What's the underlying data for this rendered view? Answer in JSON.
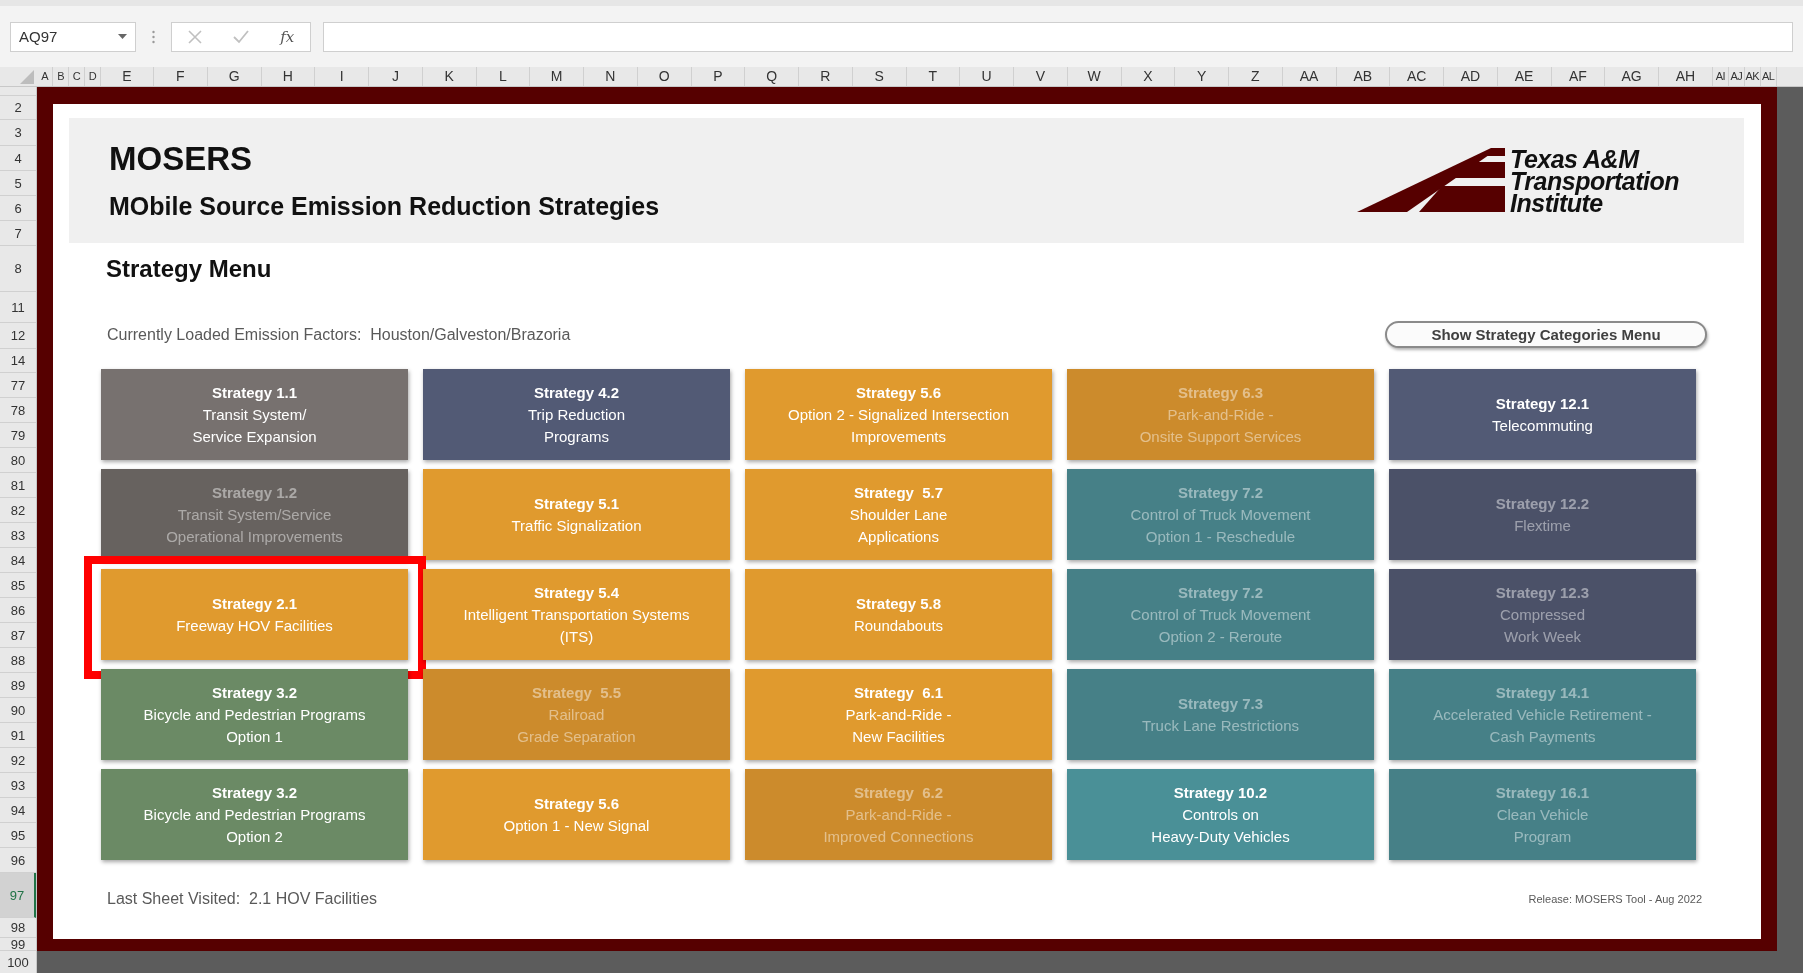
{
  "formula_bar": {
    "name_box": "AQ97",
    "function_label": "fx"
  },
  "column_headers": [
    "A",
    "B",
    "C",
    "D",
    "E",
    "F",
    "G",
    "H",
    "I",
    "J",
    "K",
    "L",
    "M",
    "N",
    "O",
    "P",
    "Q",
    "R",
    "S",
    "T",
    "U",
    "V",
    "W",
    "X",
    "Y",
    "Z",
    "AA",
    "AB",
    "AC",
    "AD",
    "AE",
    "AF",
    "AG",
    "AH",
    "AI",
    "AJ",
    "AK",
    "AL"
  ],
  "row_headers": [
    {
      "label": "2",
      "selected": false
    },
    {
      "label": "3",
      "selected": false
    },
    {
      "label": "4",
      "selected": false
    },
    {
      "label": "5",
      "selected": false
    },
    {
      "label": "6",
      "selected": false
    },
    {
      "label": "7",
      "selected": false
    },
    {
      "label": "8",
      "selected": false
    },
    {
      "label": "11",
      "selected": false
    },
    {
      "label": "12",
      "selected": false
    },
    {
      "label": "14",
      "selected": false
    },
    {
      "label": "77",
      "selected": false
    },
    {
      "label": "78",
      "selected": false
    },
    {
      "label": "79",
      "selected": false
    },
    {
      "label": "80",
      "selected": false
    },
    {
      "label": "81",
      "selected": false
    },
    {
      "label": "82",
      "selected": false
    },
    {
      "label": "83",
      "selected": false
    },
    {
      "label": "84",
      "selected": false
    },
    {
      "label": "85",
      "selected": false
    },
    {
      "label": "86",
      "selected": false
    },
    {
      "label": "87",
      "selected": false
    },
    {
      "label": "88",
      "selected": false
    },
    {
      "label": "89",
      "selected": false
    },
    {
      "label": "90",
      "selected": false
    },
    {
      "label": "91",
      "selected": false
    },
    {
      "label": "92",
      "selected": false
    },
    {
      "label": "93",
      "selected": false
    },
    {
      "label": "94",
      "selected": false
    },
    {
      "label": "95",
      "selected": false
    },
    {
      "label": "96",
      "selected": false
    },
    {
      "label": "97",
      "selected": true
    },
    {
      "label": "98",
      "selected": false
    },
    {
      "label": "99",
      "selected": false
    },
    {
      "label": "100",
      "selected": false
    }
  ],
  "header": {
    "title": "MOSERS",
    "subtitle": "MObile Source Emission Reduction Strategies",
    "logo_lines": [
      "Texas A&M",
      "Transportation",
      "Institute"
    ]
  },
  "menu_title": "Strategy Menu",
  "emission_factors": "Currently Loaded Emission Factors:  Houston/Galveston/Brazoria",
  "categories_button": "Show Strategy Categories Menu",
  "tiles": [
    {
      "title": "Strategy 1.1",
      "lines": [
        "Transit System/",
        "Service Expansion"
      ],
      "color": "#77716f",
      "disabled": false,
      "selected": false
    },
    {
      "title": "Strategy 4.2",
      "lines": [
        "Trip Reduction",
        "Programs"
      ],
      "color": "#525a75",
      "disabled": false,
      "selected": false
    },
    {
      "title": "Strategy 5.6",
      "lines": [
        "Option 2 - Signalized Intersection",
        "Improvements"
      ],
      "color": "#e09a2e",
      "disabled": false,
      "selected": false
    },
    {
      "title": "Strategy 6.3",
      "lines": [
        "Park-and-Ride -",
        "Onsite Support Services"
      ],
      "color": "#cc8b2c",
      "disabled": true,
      "selected": false
    },
    {
      "title": "Strategy 12.1",
      "lines": [
        "Telecommuting"
      ],
      "color": "#525a75",
      "disabled": false,
      "selected": false
    },
    {
      "title": "Strategy 1.2",
      "lines": [
        "Transit System/Service",
        "Operational Improvements"
      ],
      "color": "#67625f",
      "disabled": true,
      "selected": false
    },
    {
      "title": "Strategy 5.1",
      "lines": [
        "Traffic Signalization"
      ],
      "color": "#e09a2e",
      "disabled": false,
      "selected": false
    },
    {
      "title": "Strategy  5.7",
      "lines": [
        "Shoulder Lane",
        "Applications"
      ],
      "color": "#e09a2e",
      "disabled": false,
      "selected": false
    },
    {
      "title": "Strategy 7.2",
      "lines": [
        "Control of Truck Movement",
        "Option 1 - Reschedule"
      ],
      "color": "#468087",
      "disabled": true,
      "selected": false
    },
    {
      "title": "Strategy 12.2",
      "lines": [
        "Flextime"
      ],
      "color": "#4b5168",
      "disabled": true,
      "selected": false
    },
    {
      "title": "Strategy 2.1",
      "lines": [
        "Freeway HOV Facilities"
      ],
      "color": "#e09a2e",
      "disabled": false,
      "selected": true
    },
    {
      "title": "Strategy 5.4",
      "lines": [
        "Intelligent Transportation Systems",
        "(ITS)"
      ],
      "color": "#e09a2e",
      "disabled": false,
      "selected": false
    },
    {
      "title": "Strategy 5.8",
      "lines": [
        "Roundabouts"
      ],
      "color": "#e09a2e",
      "disabled": false,
      "selected": false
    },
    {
      "title": "Strategy 7.2",
      "lines": [
        "Control of Truck Movement",
        "Option 2 - Reroute"
      ],
      "color": "#468087",
      "disabled": true,
      "selected": false
    },
    {
      "title": "Strategy 12.3",
      "lines": [
        "Compressed",
        "Work Week"
      ],
      "color": "#4b5168",
      "disabled": true,
      "selected": false
    },
    {
      "title": "Strategy 3.2",
      "lines": [
        "Bicycle and Pedestrian Programs",
        "Option 1"
      ],
      "color": "#6b8a65",
      "disabled": false,
      "selected": false
    },
    {
      "title": "Strategy  5.5",
      "lines": [
        "Railroad",
        "Grade Separation"
      ],
      "color": "#cc8b2c",
      "disabled": true,
      "selected": false
    },
    {
      "title": "Strategy  6.1",
      "lines": [
        "Park-and-Ride -",
        "New Facilities"
      ],
      "color": "#e09a2e",
      "disabled": false,
      "selected": false
    },
    {
      "title": "Strategy 7.3",
      "lines": [
        "Truck Lane Restrictions"
      ],
      "color": "#468087",
      "disabled": true,
      "selected": false
    },
    {
      "title": "Strategy 14.1",
      "lines": [
        "Accelerated Vehicle Retirement -",
        "Cash Payments"
      ],
      "color": "#468087",
      "disabled": true,
      "selected": false
    },
    {
      "title": "Strategy 3.2",
      "lines": [
        "Bicycle and Pedestrian Programs",
        "Option 2"
      ],
      "color": "#6b8a65",
      "disabled": false,
      "selected": false
    },
    {
      "title": "Strategy 5.6",
      "lines": [
        "Option 1 - New Signal"
      ],
      "color": "#e09a2e",
      "disabled": false,
      "selected": false
    },
    {
      "title": "Strategy  6.2",
      "lines": [
        "Park-and-Ride -",
        "Improved Connections"
      ],
      "color": "#cc8b2c",
      "disabled": true,
      "selected": false
    },
    {
      "title": "Strategy 10.2",
      "lines": [
        "Controls on",
        "Heavy-Duty Vehicles"
      ],
      "color": "#4a9097",
      "disabled": false,
      "selected": false
    },
    {
      "title": "Strategy 16.1",
      "lines": [
        "Clean Vehicle",
        "Program"
      ],
      "color": "#468087",
      "disabled": true,
      "selected": false
    }
  ],
  "last_sheet": "Last Sheet Visited:  2.1 HOV Facilities",
  "release": "Release: MOSERS Tool - Aug 2022"
}
